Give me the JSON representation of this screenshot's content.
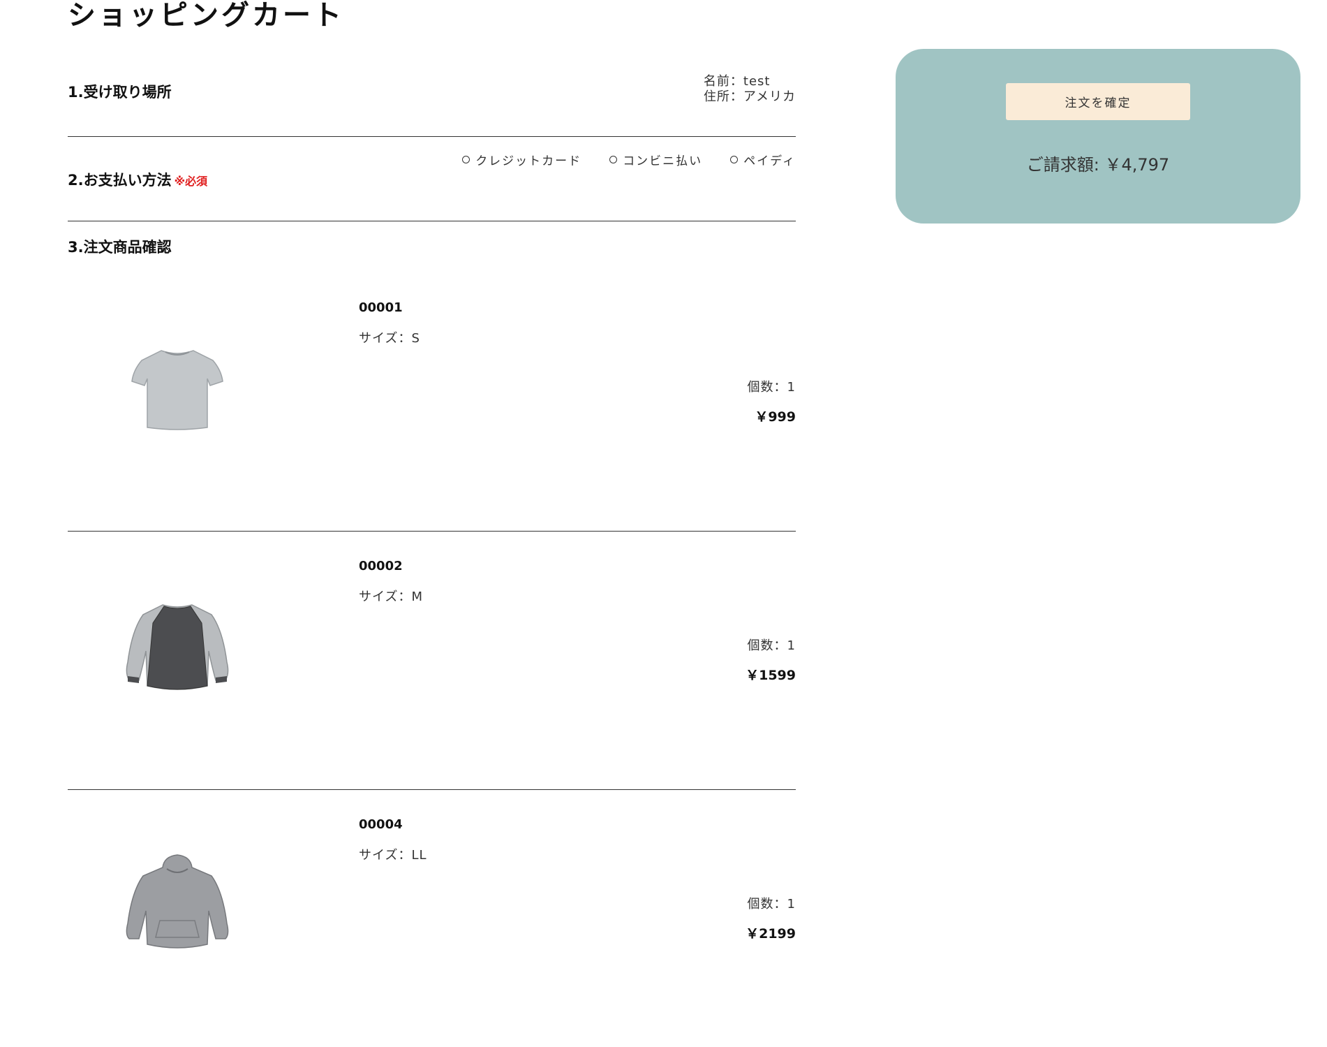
{
  "page": {
    "title": "ショッピングカート"
  },
  "pickup": {
    "label": "1.受け取り場所",
    "name_line": "名前：test",
    "address_line": "住所：アメリカ"
  },
  "payment": {
    "label": "2.お支払い方法",
    "required": "※必須",
    "options": [
      "クレジットカード",
      "コンビニ払い",
      "ペイディ"
    ]
  },
  "order": {
    "label": "3.注文商品確認",
    "items": [
      {
        "code": "00001",
        "size": "サイズ：S",
        "qty": "個数：1",
        "price": "￥999",
        "icon": "tshirt-icon"
      },
      {
        "code": "00002",
        "size": "サイズ：M",
        "qty": "個数：1",
        "price": "￥1599",
        "icon": "raglan-sweatshirt-icon"
      },
      {
        "code": "00004",
        "size": "サイズ：LL",
        "qty": "個数：1",
        "price": "￥2199",
        "icon": "hoodie-icon"
      }
    ]
  },
  "summary": {
    "confirm_label": "注文を確定",
    "total": "ご請求額: ￥4,797"
  },
  "colors": {
    "panel": "#a0c4c3",
    "button": "#faebd7",
    "required": "#e02020"
  }
}
